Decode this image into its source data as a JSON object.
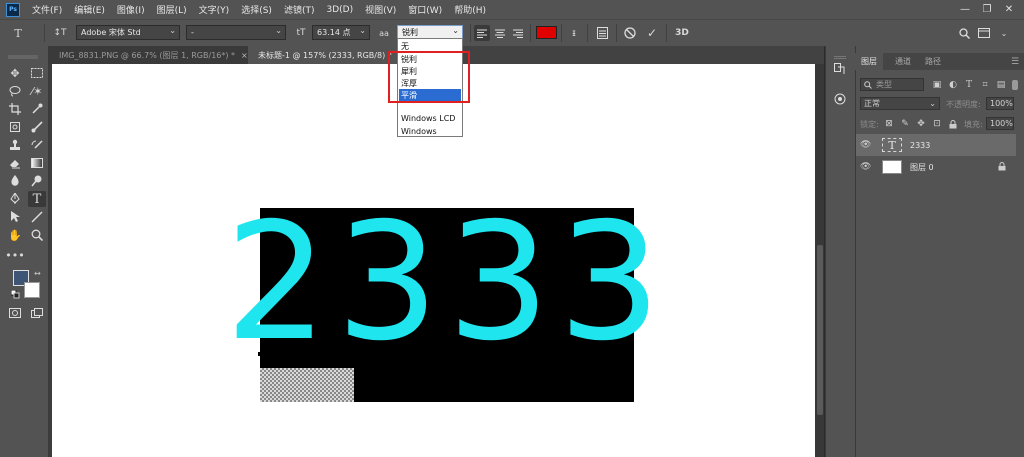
{
  "app": {
    "logo_text": "Ps"
  },
  "menu": [
    "文件(F)",
    "编辑(E)",
    "图像(I)",
    "图层(L)",
    "文字(Y)",
    "选择(S)",
    "滤镜(T)",
    "3D(D)",
    "视图(V)",
    "窗口(W)",
    "帮助(H)"
  ],
  "window_controls": {
    "minimize": "—",
    "restore": "❐",
    "close": "✕"
  },
  "options": {
    "tool_icon": "T",
    "orient_icon": "↕T",
    "font_family": "Adobe 宋体 Std",
    "font_style": "-",
    "font_size_icon": "tT",
    "font_size": "63.14 点",
    "aa_icon": "aa",
    "antialias": "锐利",
    "text_color": "#e00000",
    "three_d": "3D"
  },
  "antialias_options": [
    "无",
    "锐利",
    "犀利",
    "浑厚",
    "平滑",
    "Windows LCD",
    "Windows"
  ],
  "antialias_selected_index": 4,
  "tabs": [
    {
      "label": "IMG_8831.PNG @ 66.7% (图层 1, RGB/16*) *",
      "close": "×"
    },
    {
      "label": "未标题-1 @ 157% (2333, RGB/8) *",
      "close": "×"
    }
  ],
  "canvas": {
    "text": "2333",
    "text_color": "#1ee5ee"
  },
  "panel": {
    "tabs": [
      "图层",
      "通道",
      "路径"
    ],
    "filter_placeholder": "类型",
    "blend_mode": "正常",
    "opacity_label": "不透明度:",
    "opacity_value": "100%",
    "lock_label": "锁定:",
    "fill_label": "填充:",
    "fill_value": "100%",
    "layers": [
      {
        "name": "2333",
        "thumb": "T"
      },
      {
        "name": "图层 0",
        "thumb": ""
      }
    ],
    "lock_glyph": "🔒"
  }
}
